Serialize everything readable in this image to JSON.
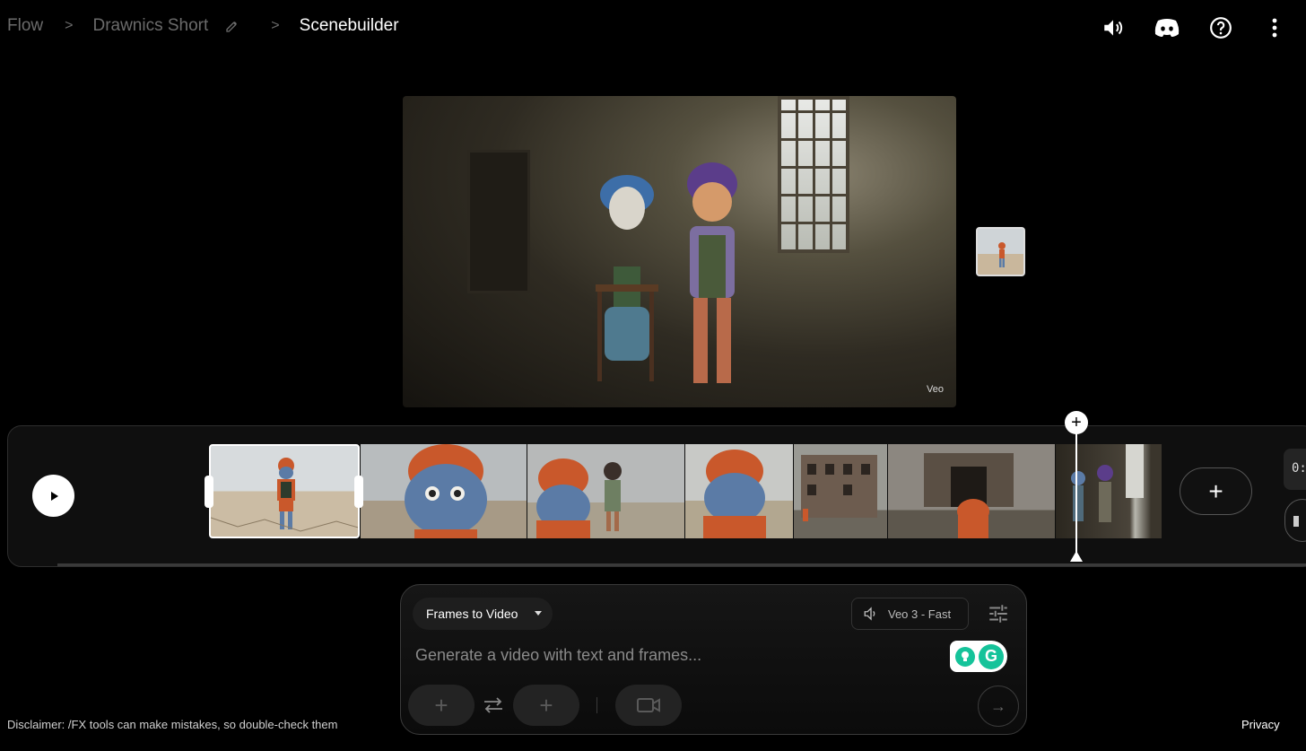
{
  "breadcrumb": {
    "root": "Flow",
    "project": "Drawnics Short",
    "current": "Scenebuilder",
    "separator": ">"
  },
  "header_icons": [
    "volume-icon",
    "discord-icon",
    "help-icon",
    "more-vert-icon"
  ],
  "preview": {
    "watermark": "Veo"
  },
  "timeline": {
    "clips": [
      {
        "name": "clip-desert-character",
        "selected": true
      },
      {
        "name": "clip-closeup-face"
      },
      {
        "name": "clip-two-characters"
      },
      {
        "name": "clip-back-view"
      },
      {
        "name": "clip-ruined-buildings"
      },
      {
        "name": "clip-ruin-doorway"
      },
      {
        "name": "clip-room-characters"
      }
    ],
    "playhead_plus": "+",
    "add_clip_label": "+",
    "time_display": "0:"
  },
  "prompt": {
    "mode": "Frames to Video",
    "model": "Veo 3 - Fast",
    "placeholder": "Generate a video with text and frames...",
    "frame_start_label": "+",
    "frame_end_label": "+",
    "send_label": "→",
    "grammarly_logo": "G"
  },
  "footer": {
    "disclaimer": "Disclaimer: /FX tools can make mistakes, so double-check them",
    "privacy": "Privacy"
  },
  "colors": {
    "background": "#000000",
    "panel": "#0f0f0f",
    "grammarly": "#15c39a",
    "clip_orange": "#c9582b",
    "clip_blue": "#5b7ba6"
  }
}
